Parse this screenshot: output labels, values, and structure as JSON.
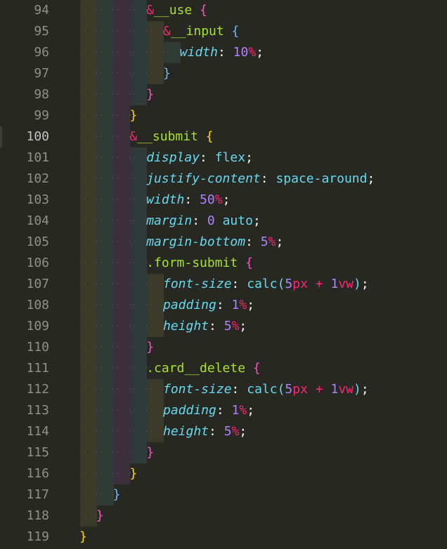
{
  "editor": {
    "lines": [
      {
        "n": "94",
        "indent": 4,
        "tokens": [
          {
            "t": "&",
            "c": "t-amp"
          },
          {
            "t": "__use",
            "c": "t-sel"
          },
          {
            "t": " "
          },
          {
            "t": "{",
            "c": "b-pink"
          }
        ]
      },
      {
        "n": "95",
        "indent": 5,
        "tokens": [
          {
            "t": "&",
            "c": "t-amp"
          },
          {
            "t": "__input",
            "c": "t-sel"
          },
          {
            "t": " "
          },
          {
            "t": "{",
            "c": "b-blue"
          }
        ]
      },
      {
        "n": "96",
        "indent": 6,
        "tokens": [
          {
            "t": "width",
            "c": "t-prop"
          },
          {
            "t": ": "
          },
          {
            "t": "10",
            "c": "t-num"
          },
          {
            "t": "%",
            "c": "t-unit"
          },
          {
            "t": ";"
          }
        ]
      },
      {
        "n": "97",
        "indent": 5,
        "tokens": [
          {
            "t": "}",
            "c": "b-blue"
          }
        ]
      },
      {
        "n": "98",
        "indent": 4,
        "tokens": [
          {
            "t": "}",
            "c": "b-pink"
          }
        ]
      },
      {
        "n": "99",
        "indent": 3,
        "tokens": [
          {
            "t": "}",
            "c": "b-yel"
          }
        ]
      },
      {
        "n": "100",
        "indent": 3,
        "tokens": [
          {
            "t": "&",
            "c": "t-amp"
          },
          {
            "t": "__submit",
            "c": "t-sel"
          },
          {
            "t": " "
          },
          {
            "t": "{",
            "c": "b-yel"
          }
        ]
      },
      {
        "n": "101",
        "indent": 4,
        "tokens": [
          {
            "t": "display",
            "c": "t-prop"
          },
          {
            "t": ": "
          },
          {
            "t": "flex",
            "c": "t-val"
          },
          {
            "t": ";"
          }
        ]
      },
      {
        "n": "102",
        "indent": 4,
        "tokens": [
          {
            "t": "justify-content",
            "c": "t-prop"
          },
          {
            "t": ": "
          },
          {
            "t": "space-around",
            "c": "t-val"
          },
          {
            "t": ";"
          }
        ]
      },
      {
        "n": "103",
        "indent": 4,
        "tokens": [
          {
            "t": "width",
            "c": "t-prop"
          },
          {
            "t": ": "
          },
          {
            "t": "50",
            "c": "t-num"
          },
          {
            "t": "%",
            "c": "t-unit"
          },
          {
            "t": ";"
          }
        ]
      },
      {
        "n": "104",
        "indent": 4,
        "tokens": [
          {
            "t": "margin",
            "c": "t-prop"
          },
          {
            "t": ": "
          },
          {
            "t": "0",
            "c": "t-num"
          },
          {
            "t": " "
          },
          {
            "t": "auto",
            "c": "t-val"
          },
          {
            "t": ";"
          }
        ]
      },
      {
        "n": "105",
        "indent": 4,
        "tokens": [
          {
            "t": "margin-bottom",
            "c": "t-prop"
          },
          {
            "t": ": "
          },
          {
            "t": "5",
            "c": "t-num"
          },
          {
            "t": "%",
            "c": "t-unit"
          },
          {
            "t": ";"
          }
        ]
      },
      {
        "n": "106",
        "indent": 4,
        "tokens": [
          {
            "t": ".form-submit",
            "c": "t-sel"
          },
          {
            "t": " "
          },
          {
            "t": "{",
            "c": "b-pink"
          }
        ]
      },
      {
        "n": "107",
        "indent": 5,
        "tokens": [
          {
            "t": "font-size",
            "c": "t-prop"
          },
          {
            "t": ": "
          },
          {
            "t": "calc(",
            "c": "t-val"
          },
          {
            "t": "5",
            "c": "t-num"
          },
          {
            "t": "px",
            "c": "t-unit"
          },
          {
            "t": " "
          },
          {
            "t": "+",
            "c": "t-unit"
          },
          {
            "t": " "
          },
          {
            "t": "1",
            "c": "t-num"
          },
          {
            "t": "vw",
            "c": "t-unit"
          },
          {
            "t": ")",
            "c": "t-val"
          },
          {
            "t": ";"
          }
        ]
      },
      {
        "n": "108",
        "indent": 5,
        "tokens": [
          {
            "t": "padding",
            "c": "t-prop"
          },
          {
            "t": ": "
          },
          {
            "t": "1",
            "c": "t-num"
          },
          {
            "t": "%",
            "c": "t-unit"
          },
          {
            "t": ";"
          }
        ]
      },
      {
        "n": "109",
        "indent": 5,
        "tokens": [
          {
            "t": "height",
            "c": "t-prop"
          },
          {
            "t": ": "
          },
          {
            "t": "5",
            "c": "t-num"
          },
          {
            "t": "%",
            "c": "t-unit"
          },
          {
            "t": ";"
          }
        ]
      },
      {
        "n": "110",
        "indent": 4,
        "tokens": [
          {
            "t": "}",
            "c": "b-pink"
          }
        ]
      },
      {
        "n": "111",
        "indent": 4,
        "tokens": [
          {
            "t": ".card__delete",
            "c": "t-sel"
          },
          {
            "t": " "
          },
          {
            "t": "{",
            "c": "b-pink"
          }
        ]
      },
      {
        "n": "112",
        "indent": 5,
        "tokens": [
          {
            "t": "font-size",
            "c": "t-prop"
          },
          {
            "t": ": "
          },
          {
            "t": "calc(",
            "c": "t-val"
          },
          {
            "t": "5",
            "c": "t-num"
          },
          {
            "t": "px",
            "c": "t-unit"
          },
          {
            "t": " "
          },
          {
            "t": "+",
            "c": "t-unit"
          },
          {
            "t": " "
          },
          {
            "t": "1",
            "c": "t-num"
          },
          {
            "t": "vw",
            "c": "t-unit"
          },
          {
            "t": ")",
            "c": "t-val"
          },
          {
            "t": ";"
          }
        ]
      },
      {
        "n": "113",
        "indent": 5,
        "tokens": [
          {
            "t": "padding",
            "c": "t-prop"
          },
          {
            "t": ": "
          },
          {
            "t": "1",
            "c": "t-num"
          },
          {
            "t": "%",
            "c": "t-unit"
          },
          {
            "t": ";"
          }
        ]
      },
      {
        "n": "114",
        "indent": 5,
        "tokens": [
          {
            "t": "height",
            "c": "t-prop"
          },
          {
            "t": ": "
          },
          {
            "t": "5",
            "c": "t-num"
          },
          {
            "t": "%",
            "c": "t-unit"
          },
          {
            "t": ";"
          }
        ]
      },
      {
        "n": "115",
        "indent": 4,
        "tokens": [
          {
            "t": "}",
            "c": "b-pink"
          }
        ]
      },
      {
        "n": "116",
        "indent": 3,
        "tokens": [
          {
            "t": "}",
            "c": "b-yel"
          }
        ]
      },
      {
        "n": "117",
        "indent": 2,
        "tokens": [
          {
            "t": "}",
            "c": "b-blue"
          }
        ]
      },
      {
        "n": "118",
        "indent": 1,
        "tokens": [
          {
            "t": "}",
            "c": "b-pink"
          }
        ]
      },
      {
        "n": "119",
        "indent": 0,
        "tokens": [
          {
            "t": "}",
            "c": "b-yel"
          }
        ]
      }
    ],
    "active_line": "100",
    "guide_colors": [
      "#3b3a2a",
      "#2e3a33",
      "#3a2f3a",
      "#2e3a3a",
      "#3b3a2a",
      "#2e3a33",
      "#2e3a3a"
    ]
  }
}
